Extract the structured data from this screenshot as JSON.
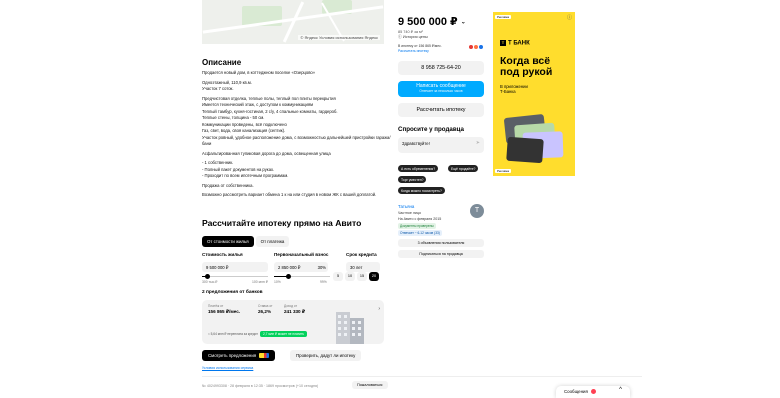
{
  "map": {
    "copyright": "© Яндекс Условия использования Яндекс"
  },
  "description": {
    "heading": "Описание",
    "paragraphs": [
      "Продается новый дом, в коттеджном поселке «Озерцово»",
      "Одноэтажный, 110,9 кв.м.\nУчасток 7 соток.",
      "Предчистовая отделка, теплые полы, теплый пол плиты перекрытия\nИмеется технический этаж, с доступом к коммуникациям\nТеплый тамбур, кухня-гостиная, 2 с/у, 4 спальные комнаты, гардероб.\nТеплые стены, толщина - 50 см.\nКоммуникации проведены, всё подключено\nГаз, свет, вода, своя канализация (септик).\nУчасток ровный, удобное расположение дома, с возможностью дальнейшей пристройки гаража/бани",
      "Асфальтированная тупиковая дорога до дома, освещенная улица",
      "- 1 собственник.\n- Полный пакет документов на руках.\n- Проходит по всем ипотечным программам.",
      "Продажа от собственника.",
      "Возможно рассмотреть вариант обмена 1 к на или студия в новом ЖК с вашей доплатой."
    ]
  },
  "mortgage": {
    "heading": "Рассчитайте ипотеку прямо на Авито",
    "tabs": [
      "От стоимости жилья",
      "От платежа"
    ],
    "labels": {
      "cost": "Стоимость жилья",
      "down": "Первоначальный взнос",
      "term": "Срок кредита"
    },
    "values": {
      "cost": "9 500 000 ₽",
      "down": "2 850 000 ₽",
      "down_pct": "30%",
      "term": "30 лет"
    },
    "cost_min": "300 тыс.₽",
    "cost_max": "100 млн ₽",
    "down_min": "10%",
    "down_max": "99%",
    "cost_level": 0.09,
    "down_level": 0.25,
    "term_options": [
      "5",
      "10",
      "15",
      "20"
    ],
    "term_selected": "20",
    "offers_title": "2 предложения от банков",
    "offer": {
      "payment_label": "Платёж от",
      "payment": "156 865 ₽/мес.",
      "rate_label": "Ставка от",
      "rate": "26,2%",
      "income_label": "Доход от",
      "income": "241 330 ₽",
      "note": "≈ 5,64 млн ₽ переплата за кредит",
      "tag": "2,7 млн ₽ может не платить"
    },
    "cta_primary": "Смотреть предложения",
    "cta_secondary": "Проверить, дадут ли ипотеку",
    "terms_link": "Условия использования сервиса"
  },
  "footer": {
    "meta": "№ 4024993308 · 28 февраля в 12:35 · 1869 просмотров (+10 сегодня)",
    "complain": "Пожаловаться"
  },
  "listing": {
    "price": "9 500 000 ₽",
    "price_chevron": "⌄",
    "price_per_m": "85 740 ₽ за м²",
    "history": "Ⓘ История цены",
    "mortgage_note": "В ипотеку от 156 865 ₽/мес.",
    "mortgage_link": "Рассчитать ипотеку",
    "phone": "8 958 725-64-20",
    "message": "Написать сообщение",
    "message_sub": "Отвечает за несколько часов",
    "calc": "Рассчитать ипотеку"
  },
  "ask": {
    "title": "Спросите у продавца",
    "placeholder": "Здравствуйте!",
    "chips": [
      "Ещё продаёте?",
      "Торг уместен?",
      "Когда можно посмотреть?"
    ],
    "chip_first": "А есть обременения?"
  },
  "seller": {
    "name": "Татьяна",
    "type": "Частное лицо",
    "since": "На Авито с февраля 2015",
    "badge_docs": "Документы проверены",
    "badge_answers": "Отвечает ~ 6-12 часов (33)",
    "avatar_letter": "Т",
    "btn_ads": "3 объявления пользователя",
    "btn_subscribe": "Подписаться на продавца"
  },
  "ad": {
    "tag": "Реклама",
    "close": "ⓘ",
    "brand": "Т БАНК",
    "headline": "Когда всё под рукой",
    "sub": "В приложении\nТ-Банка",
    "footer": "Реклама",
    "color": "#ffdd2d"
  },
  "floating": {
    "label": "Сообщения",
    "chevron": "^"
  },
  "colors": {
    "accent": "#00aaff",
    "link": "#0077ee",
    "bank_yellow": "#ffdd2d",
    "green": "#02d15c"
  }
}
